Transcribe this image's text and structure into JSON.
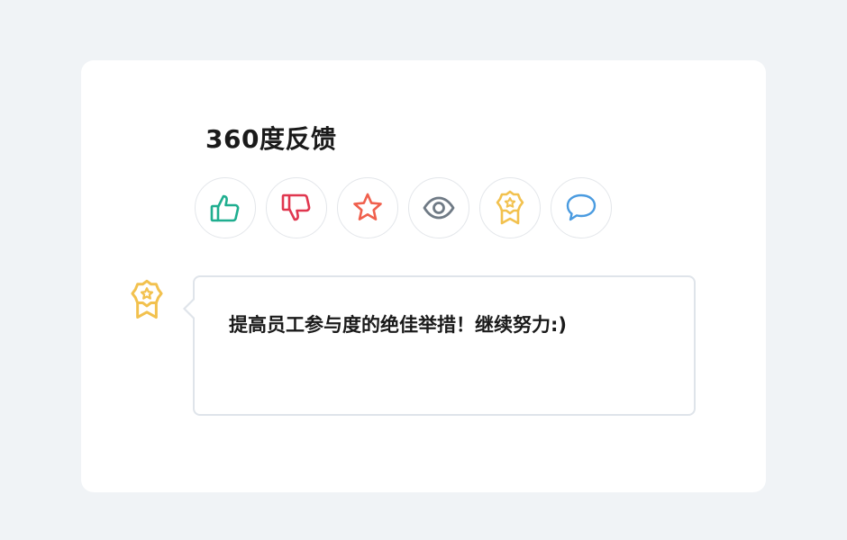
{
  "feedback": {
    "title": "360度反馈",
    "icons": [
      {
        "name": "thumbs-up-icon",
        "color": "#1fae8f"
      },
      {
        "name": "thumbs-down-icon",
        "color": "#e0374f"
      },
      {
        "name": "star-icon",
        "color": "#f0604d"
      },
      {
        "name": "eye-icon",
        "color": "#6f7a85"
      },
      {
        "name": "award-medal-icon",
        "color": "#f2c14e"
      },
      {
        "name": "speech-bubble-icon",
        "color": "#4a9be0"
      }
    ]
  },
  "comment": {
    "badge_icon": "award-medal-icon",
    "badge_color": "#f2c14e",
    "text": "提高员工参与度的绝佳举措！继续努力:)"
  }
}
